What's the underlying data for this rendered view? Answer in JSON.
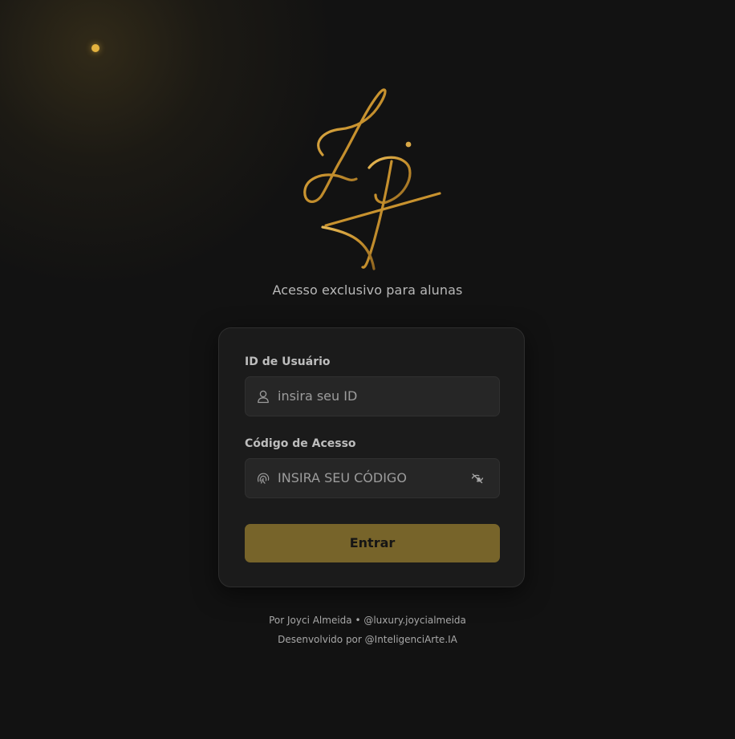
{
  "brand": {
    "logo_icon": "lj-monogram-signature-logo",
    "accent_color": "#c9962f",
    "glow_dot_color": "#e3b23f"
  },
  "header": {
    "subtitle": "Acesso exclusivo para alunas"
  },
  "login_form": {
    "user_id": {
      "label": "ID de Usuário",
      "placeholder": "insira seu ID",
      "value": "",
      "icon": "user-icon"
    },
    "access_code": {
      "label": "Código de Acesso",
      "placeholder": "INSIRA SEU CÓDIGO",
      "value": "",
      "icon": "fingerprint-icon",
      "toggle_icon": "eye-off-icon"
    },
    "submit_label": "Entrar",
    "submit_color": "#77642a"
  },
  "footer": {
    "credit": "Por Joyci Almeida • @luxury.joycialmeida",
    "developer": "Desenvolvido por @InteligenciArte.IA"
  },
  "colors": {
    "background": "#121212",
    "card": "#1b1b1b",
    "input": "#262626"
  }
}
